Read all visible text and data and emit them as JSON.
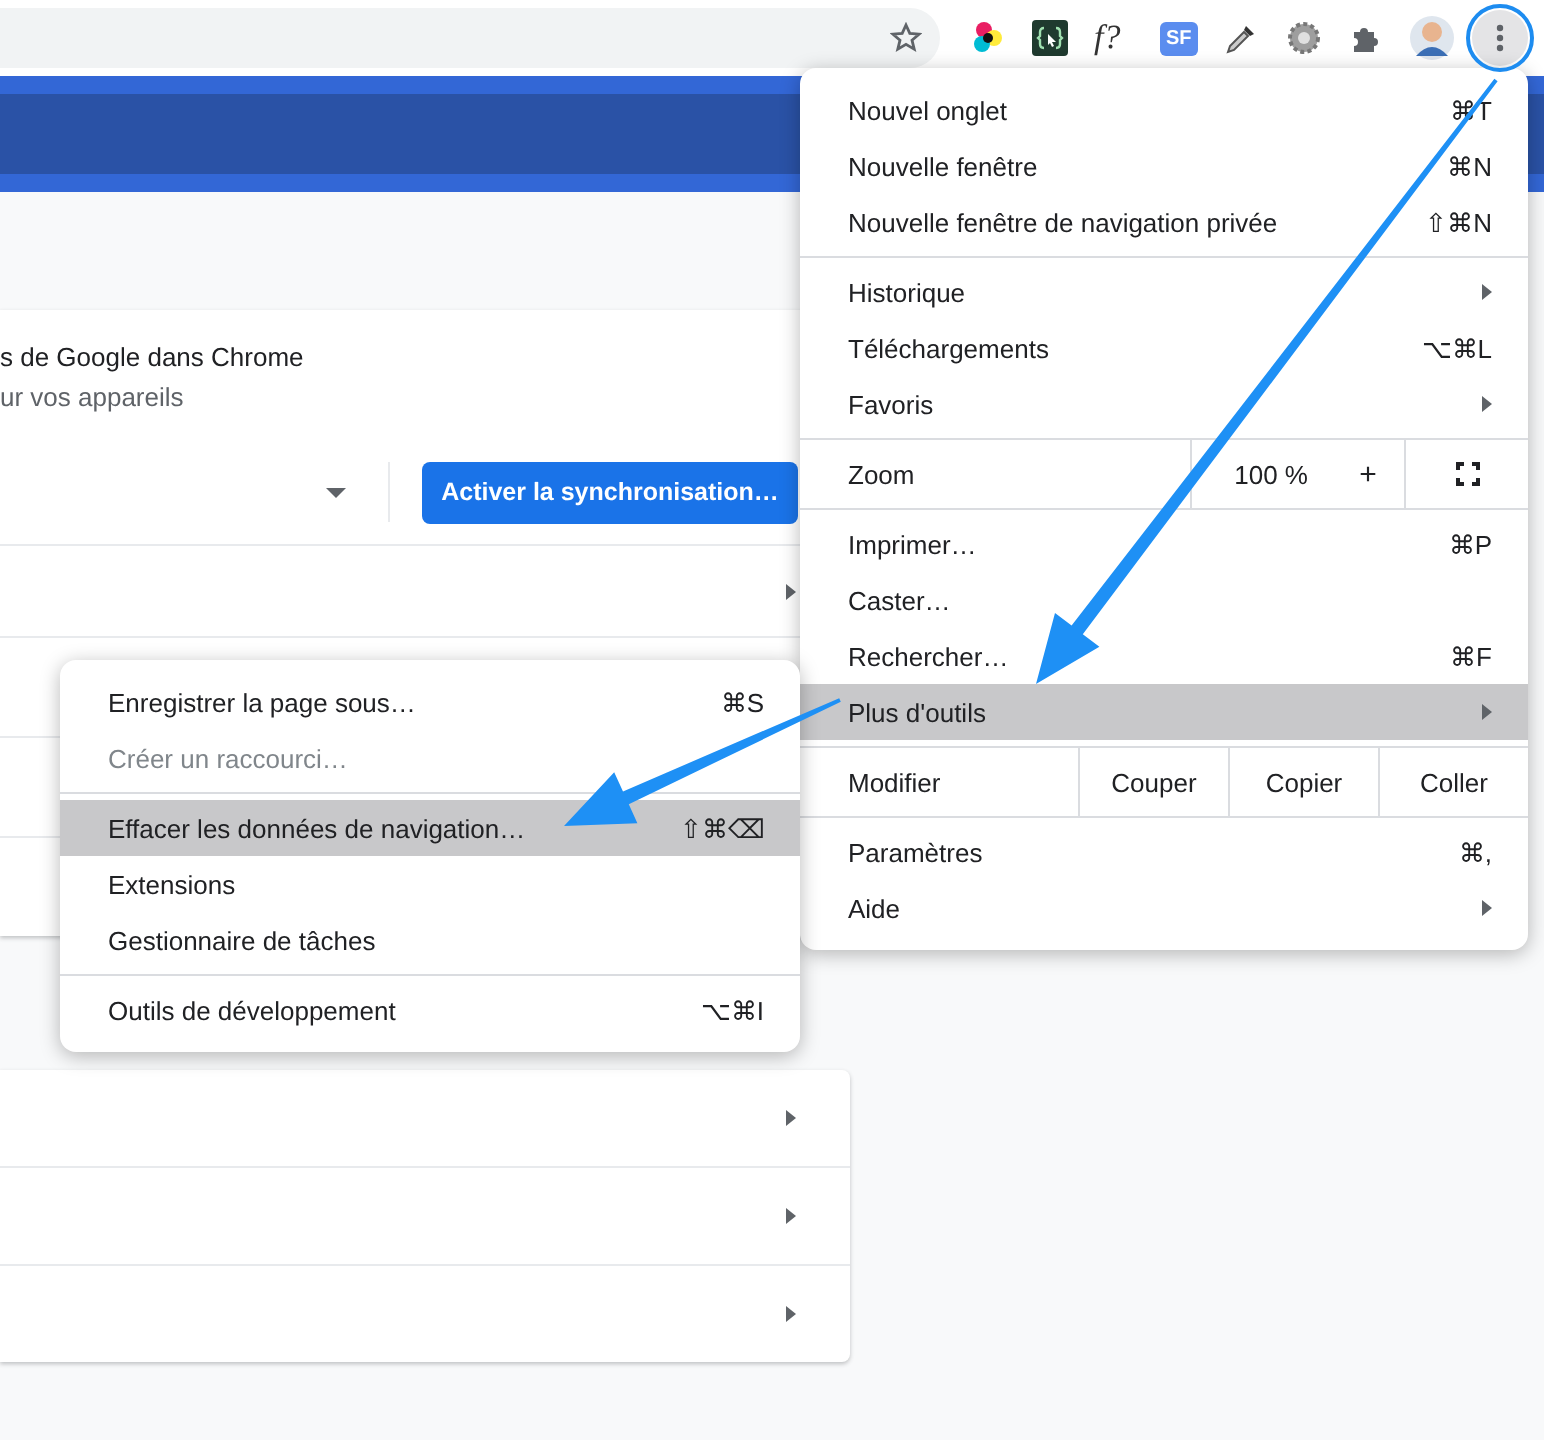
{
  "toolbar": {
    "menu_open": true,
    "extensions": [
      {
        "kind": "colors"
      },
      {
        "kind": "code"
      },
      {
        "kind": "text",
        "label": "f?"
      },
      {
        "kind": "badge",
        "label": "SF"
      },
      {
        "kind": "dropper"
      },
      {
        "kind": "gear"
      },
      {
        "kind": "puzzle"
      },
      {
        "kind": "avatar"
      }
    ]
  },
  "sync_card": {
    "line_1": "s de Google dans Chrome",
    "line_2": "ur vos appareils",
    "sync_button": "Activer la synchronisation…",
    "rows": [
      {
        "arrow": true
      }
    ]
  },
  "lower_card": {
    "rows": [
      {
        "arrow": true
      },
      {
        "arrow": true
      },
      {
        "arrow": true
      }
    ]
  },
  "main_menu": {
    "sections": [
      {
        "items": [
          {
            "kind": "item",
            "label": "Nouvel onglet",
            "shortcut": "⌘T",
            "submenu": false,
            "selected": false,
            "disabled": false
          },
          {
            "kind": "item",
            "label": "Nouvelle fenêtre",
            "shortcut": "⌘N",
            "submenu": false,
            "selected": false,
            "disabled": false
          },
          {
            "kind": "item",
            "label": "Nouvelle fenêtre de navigation privée",
            "shortcut": "⇧⌘N",
            "submenu": false,
            "selected": false,
            "disabled": false
          }
        ]
      },
      {
        "items": [
          {
            "kind": "item",
            "label": "Historique",
            "submenu": true,
            "selected": false,
            "disabled": false
          },
          {
            "kind": "item",
            "label": "Téléchargements",
            "shortcut": "⌥⌘L",
            "submenu": false,
            "selected": false,
            "disabled": false
          },
          {
            "kind": "item",
            "label": "Favoris",
            "submenu": true,
            "selected": false,
            "disabled": false
          }
        ]
      },
      {
        "items": [
          {
            "kind": "zoom",
            "label": "Zoom",
            "value": "100 %",
            "plus": "+"
          }
        ]
      },
      {
        "items": [
          {
            "kind": "item",
            "label": "Imprimer…",
            "shortcut": "⌘P",
            "submenu": false,
            "selected": false,
            "disabled": false
          },
          {
            "kind": "item",
            "label": "Caster…",
            "submenu": false,
            "selected": false,
            "disabled": false
          },
          {
            "kind": "item",
            "label": "Rechercher…",
            "shortcut": "⌘F",
            "submenu": false,
            "selected": false,
            "disabled": false
          },
          {
            "kind": "item",
            "label": "Plus d'outils",
            "submenu": true,
            "selected": true,
            "disabled": false
          }
        ]
      },
      {
        "items": [
          {
            "kind": "edit",
            "label": "Modifier",
            "buttons": [
              "Couper",
              "Copier",
              "Coller"
            ]
          }
        ]
      },
      {
        "items": [
          {
            "kind": "item",
            "label": "Paramètres",
            "shortcut": "⌘,",
            "submenu": false,
            "selected": false,
            "disabled": false
          },
          {
            "kind": "item",
            "label": "Aide",
            "submenu": true,
            "selected": false,
            "disabled": false
          }
        ]
      }
    ]
  },
  "sub_menu": {
    "sections": [
      {
        "items": [
          {
            "kind": "item",
            "label": "Enregistrer la page sous…",
            "shortcut": "⌘S",
            "submenu": false,
            "selected": false,
            "disabled": false
          },
          {
            "kind": "item",
            "label": "Créer un raccourci…",
            "submenu": false,
            "selected": false,
            "disabled": true
          }
        ]
      },
      {
        "items": [
          {
            "kind": "item",
            "label": "Effacer les données de navigation…",
            "shortcut": "⇧⌘⌫",
            "submenu": false,
            "selected": true,
            "disabled": false
          },
          {
            "kind": "item",
            "label": "Extensions",
            "submenu": false,
            "selected": false,
            "disabled": false
          },
          {
            "kind": "item",
            "label": "Gestionnaire de tâches",
            "submenu": false,
            "selected": false,
            "disabled": false
          }
        ]
      },
      {
        "items": [
          {
            "kind": "item",
            "label": "Outils de développement",
            "shortcut": "⌥⌘I",
            "submenu": false,
            "selected": false,
            "disabled": false
          }
        ]
      }
    ]
  }
}
